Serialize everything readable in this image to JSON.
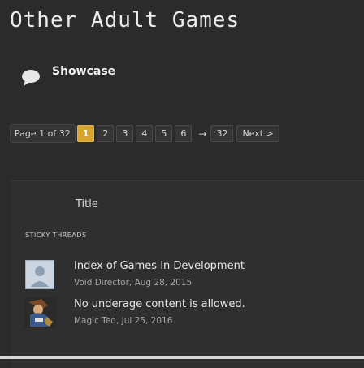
{
  "forum": {
    "title": "Other Adult Games"
  },
  "node": {
    "icon": "speech-bubble-icon",
    "label": "Showcase"
  },
  "pagination": {
    "info": "Page 1 of 32",
    "pages": [
      "1",
      "2",
      "3",
      "4",
      "5",
      "6"
    ],
    "current": "1",
    "arrow": "→",
    "last": "32",
    "next": "Next >"
  },
  "table": {
    "column_title": "Title",
    "section_label": "STICKY THREADS"
  },
  "threads": [
    {
      "title": "Index of Games In Development",
      "meta": "Void Director, Aug 28, 2015",
      "avatar": "default-user-avatar"
    },
    {
      "title": "No underage content is allowed.",
      "meta": "Magic Ted, Jul 25, 2016",
      "avatar": "character-avatar"
    }
  ],
  "colors": {
    "background": "#2b2b2b",
    "current_page": "#d6a52e",
    "text": "#e6e6e6",
    "meta": "#a6a6a6"
  }
}
